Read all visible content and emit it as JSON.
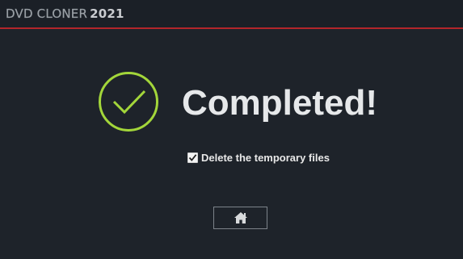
{
  "app": {
    "brand_name": "DVD CLONER",
    "brand_year": "2021",
    "accent_color": "#b3262b"
  },
  "status": {
    "title": "Completed!",
    "icon": "check-circle-icon",
    "icon_color": "#a3d63a"
  },
  "options": {
    "delete_temp_label": "Delete the temporary files",
    "delete_temp_checked": true
  },
  "actions": {
    "home_icon": "home-icon"
  }
}
